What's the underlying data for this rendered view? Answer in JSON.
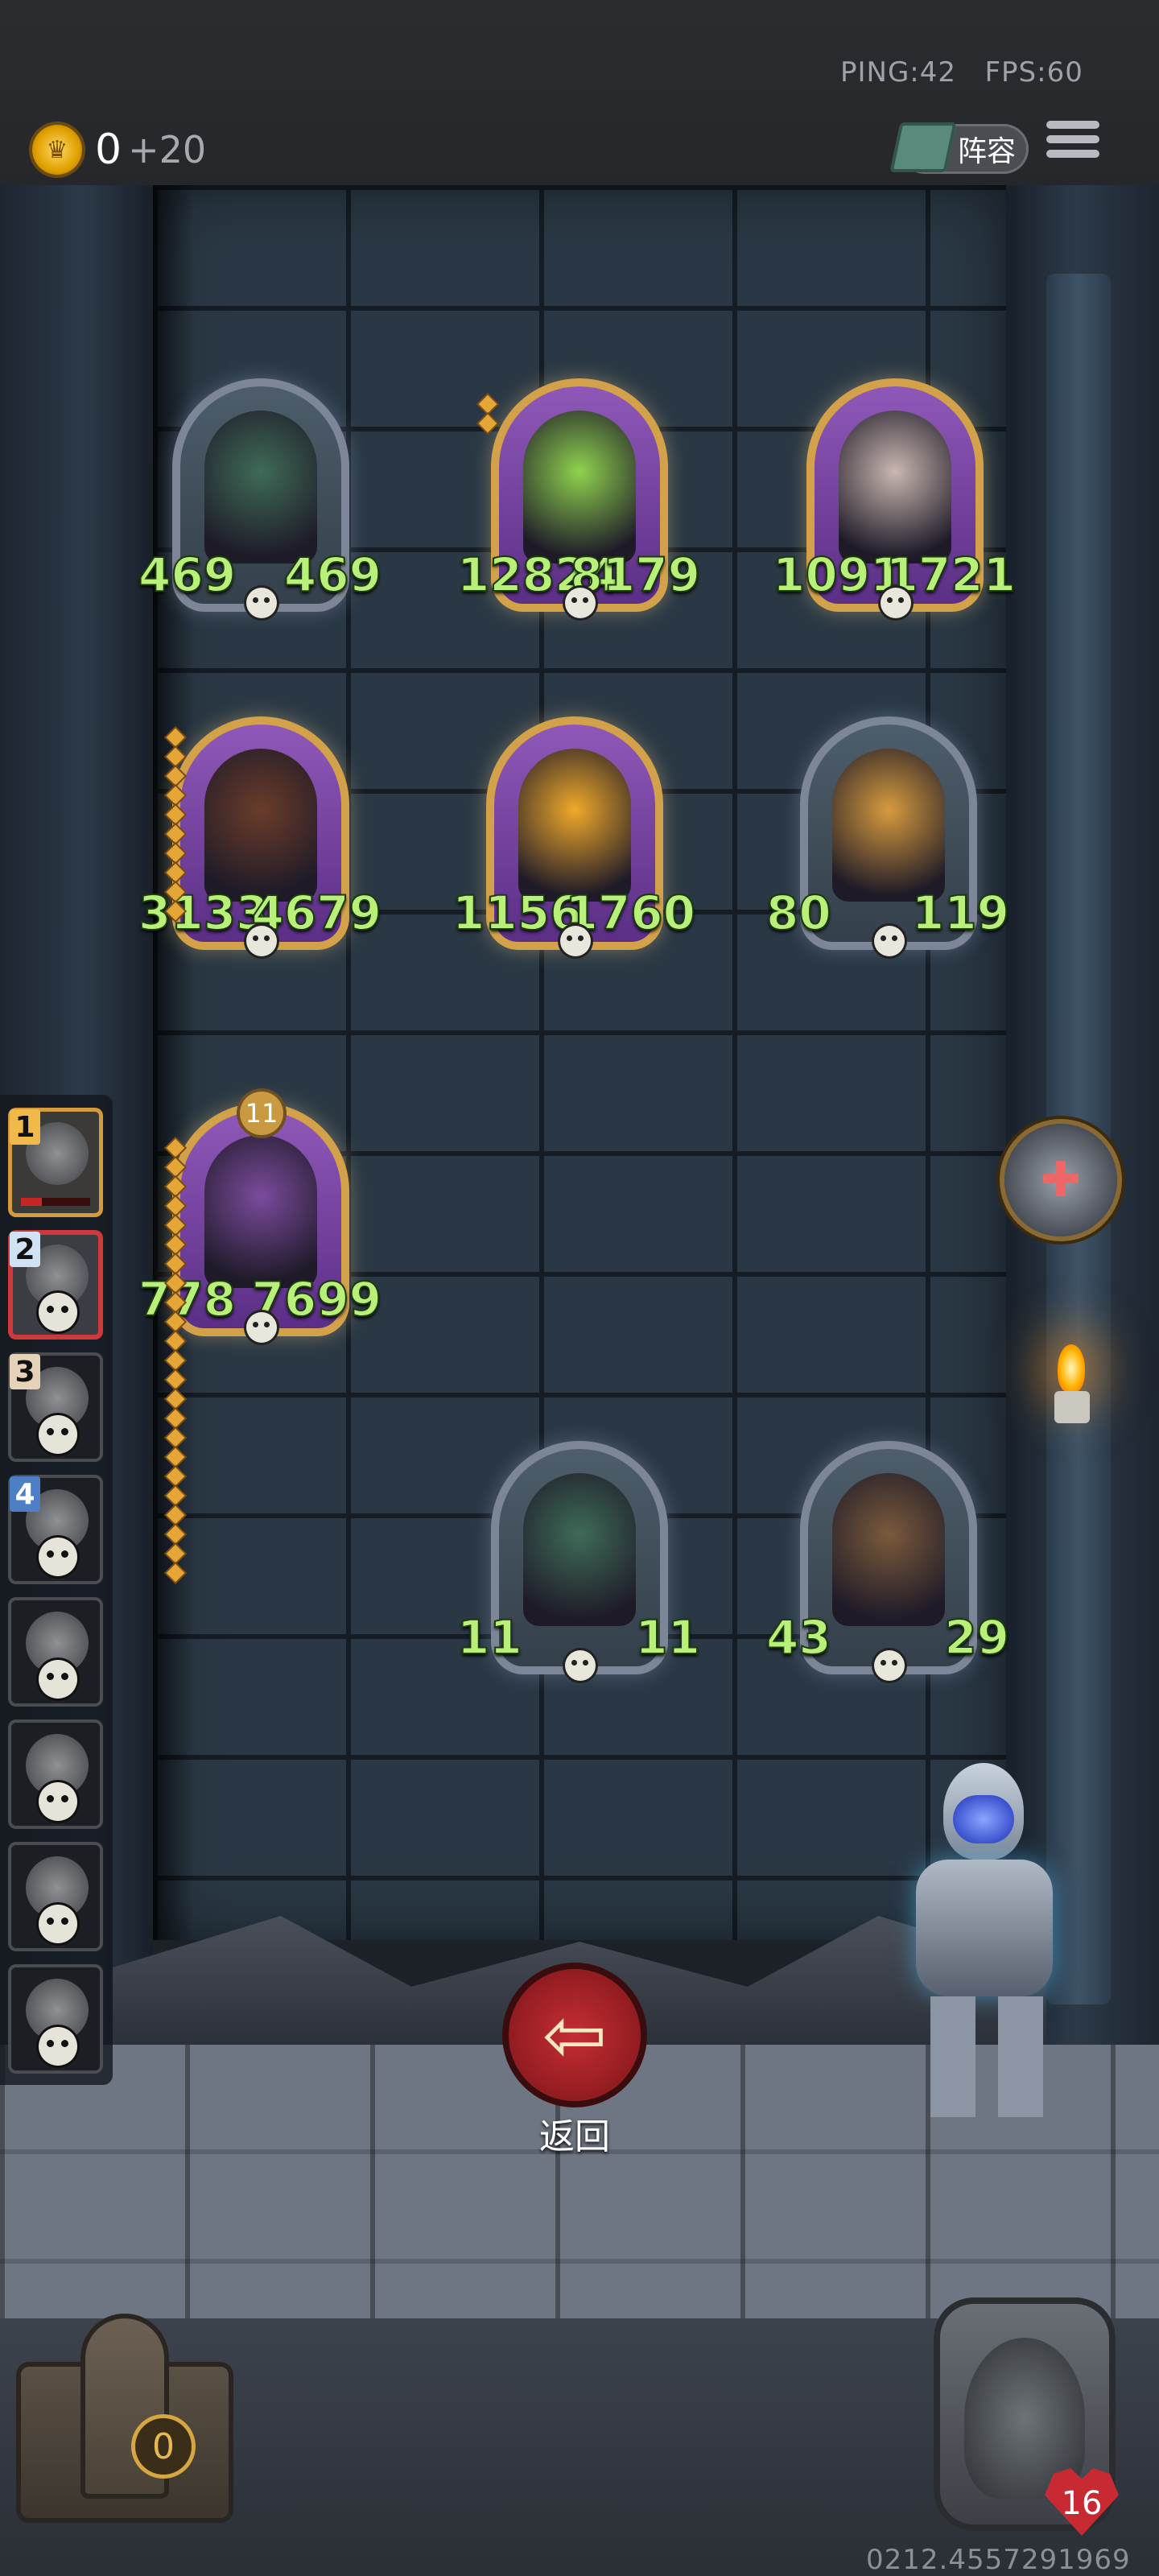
{
  "hud": {
    "ping_text": "PING:42",
    "fps_text": "FPS:60",
    "coins": "0",
    "coins_income": "+20",
    "lineup_label": "阵容"
  },
  "board": {
    "cards": [
      {
        "id": "card-dark-elf",
        "atk": "469",
        "hp": "469",
        "frame": "silver",
        "art_color": "#3f6b57"
      },
      {
        "id": "card-caterpillar",
        "atk": "12824",
        "hp": "8179",
        "frame": "gold",
        "art_color": "#8fd24e"
      },
      {
        "id": "card-masked-rabbit",
        "atk": "1091",
        "hp": "1721",
        "frame": "gold",
        "art_color": "#c9b7b0"
      },
      {
        "id": "card-boar",
        "atk": "3133",
        "hp": "4679",
        "frame": "gold",
        "art_color": "#6a3c2a"
      },
      {
        "id": "card-butterfly",
        "atk": "1156",
        "hp": "1760",
        "frame": "gold",
        "art_color": "#f0a92a"
      },
      {
        "id": "card-pinocchio",
        "atk": "80",
        "hp": "119",
        "frame": "silver",
        "art_color": "#d79b3e"
      },
      {
        "id": "card-rogue",
        "atk": "778",
        "hp": "7699",
        "frame": "gold",
        "art_color": "#7b4b9c",
        "level": "11"
      },
      {
        "id": "card-dark-elf-small",
        "atk": "11",
        "hp": "11",
        "frame": "silver",
        "art_color": "#3f6b57"
      },
      {
        "id": "card-pirate",
        "atk": "43",
        "hp": "29",
        "frame": "silver",
        "art_color": "#7a5a3c"
      }
    ]
  },
  "roster": {
    "slots": [
      {
        "rank": "1",
        "state": "first",
        "hp_fraction": 0.3
      },
      {
        "rank": "2",
        "state": "selected"
      },
      {
        "rank": "3",
        "state": "dead"
      },
      {
        "rank": "4",
        "state": "dead"
      },
      {
        "rank": "",
        "state": "dead"
      },
      {
        "rank": "",
        "state": "dead"
      },
      {
        "rank": "",
        "state": "dead"
      },
      {
        "rank": "",
        "state": "dead"
      }
    ]
  },
  "controls": {
    "back_label": "返回",
    "back_icon": "arrow-left-icon",
    "item_icon": "lighter-item-icon"
  },
  "footer": {
    "chest_count": "0",
    "player_health": "16",
    "uid": "0212.4557291969"
  },
  "colors": {
    "stat_text": "#b8f07a",
    "gold_frame": "#d2a14a",
    "silver_frame": "#7d8696",
    "back_button": "#c42e34"
  }
}
